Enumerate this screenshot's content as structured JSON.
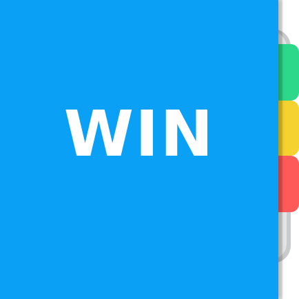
{
  "cover": {
    "title": "WIN"
  },
  "colors": {
    "cover": "#0aa0f5",
    "tab_green": "#2dd88a",
    "tab_yellow": "#f5d22f",
    "tab_red": "#ff5a5a",
    "title_text": "#ffffff"
  },
  "tabs": [
    {
      "color": "green"
    },
    {
      "color": "yellow"
    },
    {
      "color": "red"
    }
  ]
}
